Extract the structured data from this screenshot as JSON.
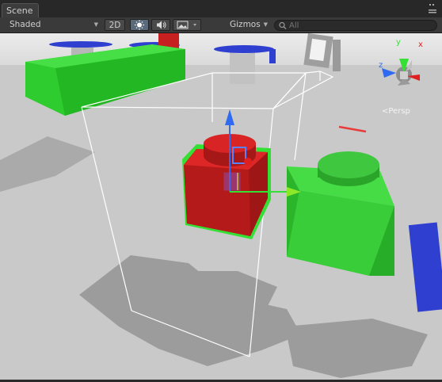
{
  "window": {
    "tab_title": "Scene"
  },
  "toolbar": {
    "draw_mode": "Shaded",
    "mode_2d": "2D",
    "gizmos_label": "Gizmos",
    "search_placeholder": "All"
  },
  "scene": {
    "view_label": "Perspective",
    "view_label_visible": "<Persp",
    "axis_labels": {
      "x": "x",
      "y": "y",
      "z": "z"
    },
    "selected_object_color": "#c62020",
    "selection_outline_color": "#35e035",
    "ground_color": "#c8c8c8",
    "sky_color": "#e4e4e4",
    "green_color": "#3ccb3c",
    "blue_color": "#2f3fd0"
  },
  "icons": {
    "sun": "sun-icon",
    "audio": "audio-icon",
    "image": "image-effects-icon",
    "search": "search-icon",
    "menu": "window-menu-icon"
  }
}
